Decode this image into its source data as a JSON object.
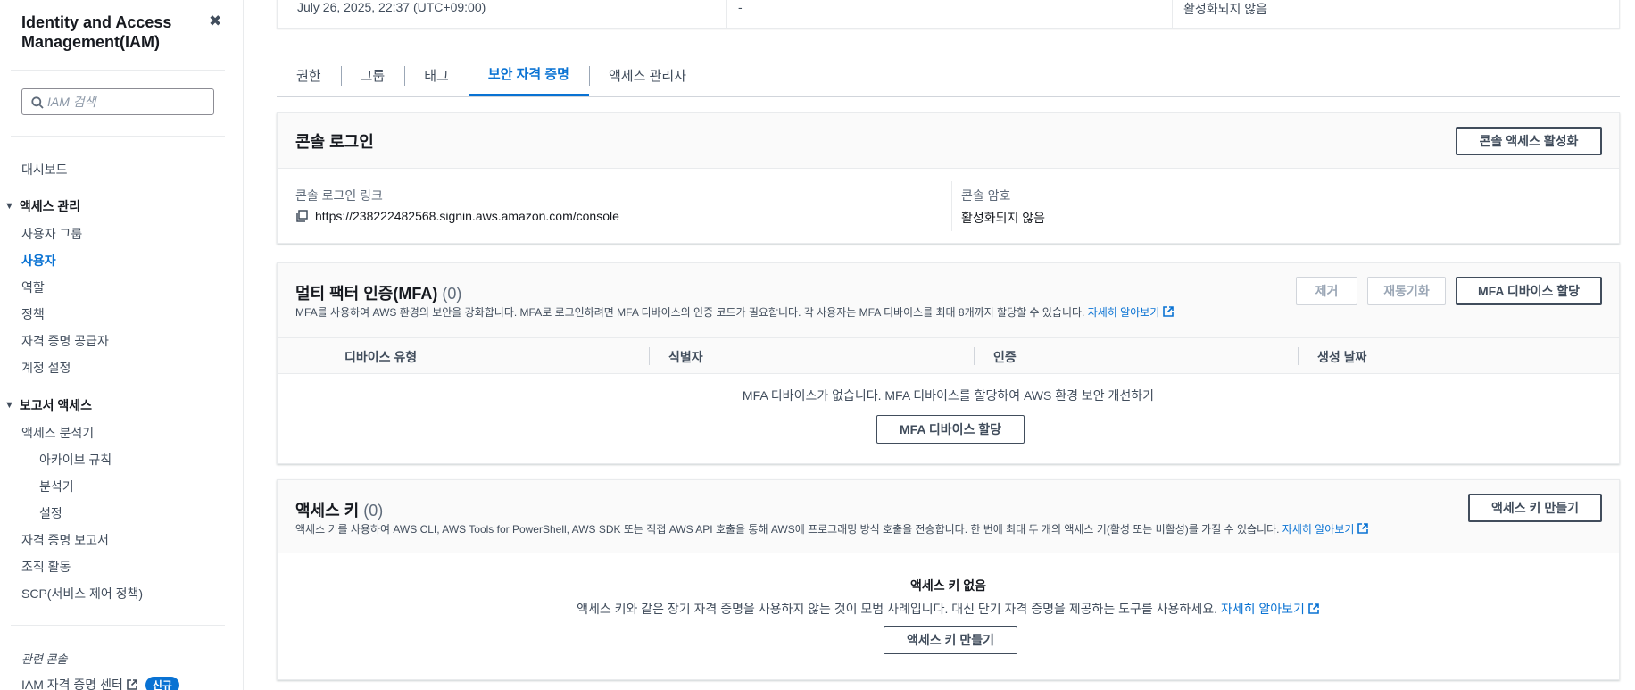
{
  "sidebar": {
    "title": "Identity and Access Management(IAM)",
    "search_placeholder": "IAM 검색",
    "dashboard": "대시보드",
    "access_management": {
      "label": "액세스 관리",
      "items": [
        "사용자 그룹",
        "사용자",
        "역할",
        "정책",
        "자격 증명 공급자",
        "계정 설정"
      ],
      "active": "사용자"
    },
    "access_reports": {
      "label": "보고서 액세스",
      "analyzer": "액세스 분석기",
      "analyzer_items": [
        "아카이브 규칙",
        "분석기",
        "설정"
      ],
      "items": [
        "자격 증명 보고서",
        "조직 활동",
        "SCP(서비스 제어 정책)"
      ]
    },
    "related_label": "관련 콘솔",
    "related_item": "IAM 자격 증명 센터",
    "new_badge": "신규"
  },
  "summary": {
    "created": "July 26, 2025, 22:37 (UTC+09:00)",
    "middle": "-",
    "right": "활성화되지 않음"
  },
  "tabs": [
    {
      "label": "권한",
      "active": false
    },
    {
      "label": "그룹",
      "active": false
    },
    {
      "label": "태그",
      "active": false
    },
    {
      "label": "보안 자격 증명",
      "active": true
    },
    {
      "label": "액세스 관리자",
      "active": false
    }
  ],
  "console_signin": {
    "title": "콘솔 로그인",
    "enable_button": "콘솔 액세스 활성화",
    "link_label": "콘솔 로그인 링크",
    "link_value": "https://238222482568.signin.aws.amazon.com/console",
    "password_label": "콘솔 암호",
    "password_value": "활성화되지 않음"
  },
  "mfa": {
    "title": "멀티 팩터 인증(MFA)",
    "count": "(0)",
    "description": "MFA를 사용하여 AWS 환경의 보안을 강화합니다. MFA로 로그인하려면 MFA 디바이스의 인증 코드가 필요합니다. 각 사용자는 MFA 디바이스를 최대 8개까지 할당할 수 있습니다.",
    "learn_more": "자세히 알아보기",
    "remove_button": "제거",
    "resync_button": "재동기화",
    "assign_button": "MFA 디바이스 할당",
    "columns": [
      "디바이스 유형",
      "식별자",
      "인증",
      "생성 날짜"
    ],
    "empty_text": "MFA 디바이스가 없습니다. MFA 디바이스를 할당하여 AWS 환경 보안 개선하기",
    "empty_button": "MFA 디바이스 할당"
  },
  "access_keys": {
    "title": "액세스 키",
    "count": "(0)",
    "description": "액세스 키를 사용하여 AWS CLI, AWS Tools for PowerShell, AWS SDK 또는 직접 AWS API 호출을 통해 AWS에 프로그래밍 방식 호출을 전송합니다. 한 번에 최대 두 개의 액세스 키(활성 또는 비활성)를 가질 수 있습니다.",
    "learn_more": "자세히 알아보기",
    "create_button": "액세스 키 만들기",
    "empty_title": "액세스 키 없음",
    "empty_text": "액세스 키와 같은 장기 자격 증명을 사용하지 않는 것이 모범 사례입니다. 대신 단기 자격 증명을 제공하는 도구를 사용하세요.",
    "empty_learn_more": "자세히 알아보기",
    "empty_button": "액세스 키 만들기"
  },
  "icons": {
    "close": "close-icon",
    "search": "search-icon",
    "caret": "caret-down-icon",
    "copy": "copy-icon",
    "external": "external-link-icon"
  },
  "colors": {
    "accent": "#0972d3",
    "text": "#16191f",
    "muted": "#414d5c"
  }
}
